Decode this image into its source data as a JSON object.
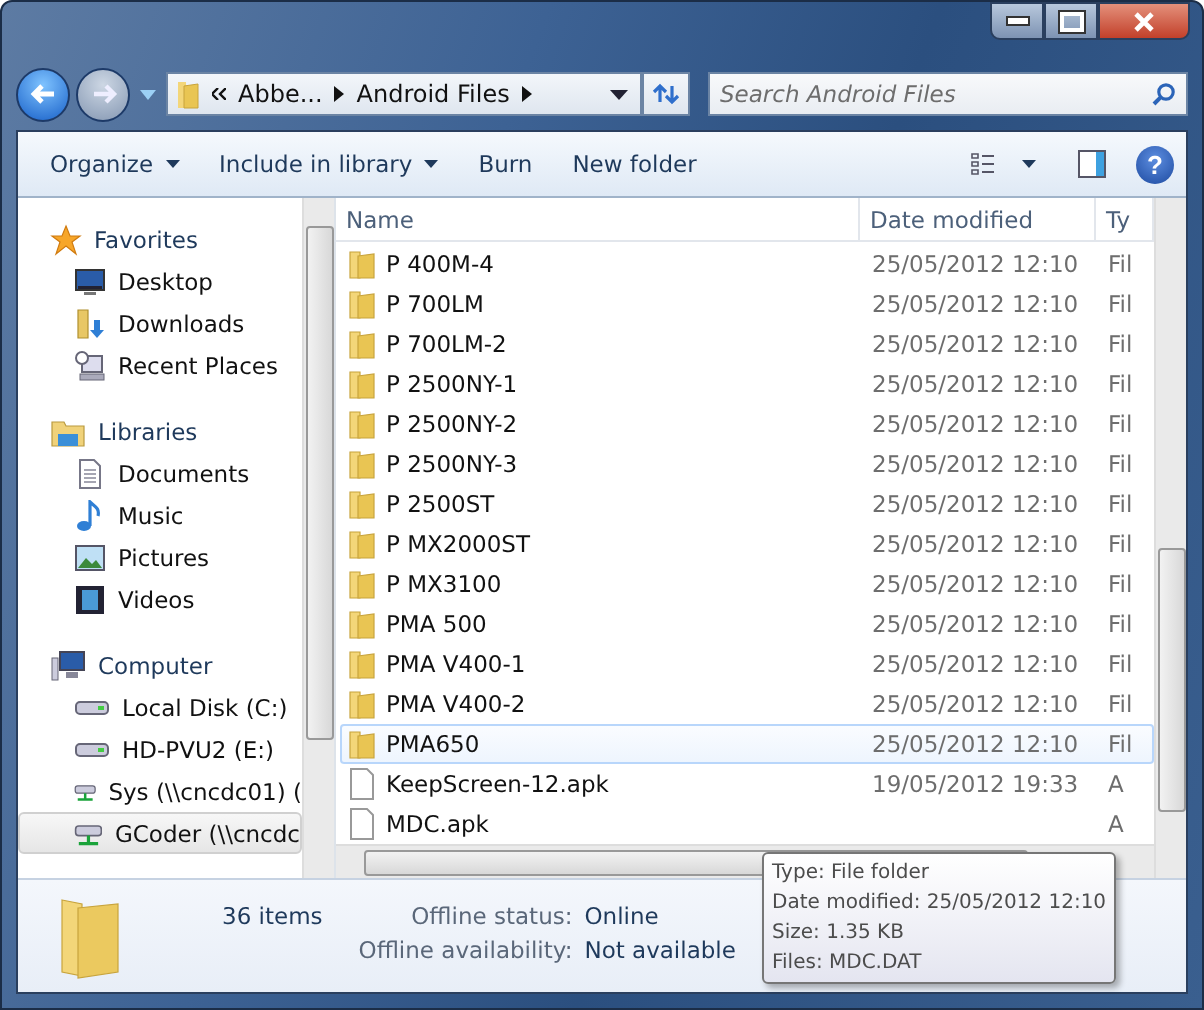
{
  "address_bar": {
    "segments": [
      "Abbe...",
      "Android Files"
    ]
  },
  "search": {
    "placeholder": "Search Android Files"
  },
  "help_button": "?",
  "toolbar": {
    "buttons": [
      {
        "label": "Organize",
        "dropdown": true
      },
      {
        "label": "Include in library",
        "dropdown": true
      },
      {
        "label": "Burn",
        "dropdown": false
      },
      {
        "label": "New folder",
        "dropdown": false
      }
    ]
  },
  "sidebar": {
    "groups": [
      {
        "label": "Favorites",
        "kind": "star",
        "children": [
          {
            "label": "Desktop",
            "kind": "desktop",
            "selected": false
          },
          {
            "label": "Downloads",
            "kind": "downloads",
            "selected": false
          },
          {
            "label": "Recent Places",
            "kind": "recent",
            "selected": false
          }
        ]
      },
      {
        "label": "Libraries",
        "kind": "library",
        "children": [
          {
            "label": "Documents",
            "kind": "document",
            "selected": false
          },
          {
            "label": "Music",
            "kind": "music",
            "selected": false
          },
          {
            "label": "Pictures",
            "kind": "picture",
            "selected": false
          },
          {
            "label": "Videos",
            "kind": "video",
            "selected": false
          }
        ]
      },
      {
        "label": "Computer",
        "kind": "computer",
        "children": [
          {
            "label": "Local Disk (C:)",
            "kind": "disk",
            "selected": false
          },
          {
            "label": "HD-PVU2 (E:)",
            "kind": "disk",
            "selected": false
          },
          {
            "label": "Sys (\\\\cncdc01) (",
            "kind": "network",
            "selected": false
          },
          {
            "label": "GCoder (\\\\cncdc",
            "kind": "network",
            "selected": true
          }
        ]
      }
    ]
  },
  "file_list": {
    "columns": [
      "Name",
      "Date modified",
      "Ty"
    ],
    "rows": [
      {
        "name": "P 400M-4",
        "date": "25/05/2012 12:10",
        "column_3": "Fil",
        "kind": "folder",
        "selected": false
      },
      {
        "name": "P 700LM",
        "date": "25/05/2012 12:10",
        "column_3": "Fil",
        "kind": "folder",
        "selected": false
      },
      {
        "name": "P 700LM-2",
        "date": "25/05/2012 12:10",
        "column_3": "Fil",
        "kind": "folder",
        "selected": false
      },
      {
        "name": "P 2500NY-1",
        "date": "25/05/2012 12:10",
        "column_3": "Fil",
        "kind": "folder",
        "selected": false
      },
      {
        "name": "P 2500NY-2",
        "date": "25/05/2012 12:10",
        "column_3": "Fil",
        "kind": "folder",
        "selected": false
      },
      {
        "name": "P 2500NY-3",
        "date": "25/05/2012 12:10",
        "column_3": "Fil",
        "kind": "folder",
        "selected": false
      },
      {
        "name": "P 2500ST",
        "date": "25/05/2012 12:10",
        "column_3": "Fil",
        "kind": "folder",
        "selected": false
      },
      {
        "name": "P MX2000ST",
        "date": "25/05/2012 12:10",
        "column_3": "Fil",
        "kind": "folder",
        "selected": false
      },
      {
        "name": "P MX3100",
        "date": "25/05/2012 12:10",
        "column_3": "Fil",
        "kind": "folder",
        "selected": false
      },
      {
        "name": "PMA 500",
        "date": "25/05/2012 12:10",
        "column_3": "Fil",
        "kind": "folder",
        "selected": false
      },
      {
        "name": "PMA V400-1",
        "date": "25/05/2012 12:10",
        "column_3": "Fil",
        "kind": "folder",
        "selected": false
      },
      {
        "name": "PMA V400-2",
        "date": "25/05/2012 12:10",
        "column_3": "Fil",
        "kind": "folder",
        "selected": false
      },
      {
        "name": "PMA650",
        "date": "25/05/2012 12:10",
        "column_3": "Fil",
        "kind": "folder",
        "selected": true
      },
      {
        "name": "KeepScreen-12.apk",
        "date": "19/05/2012 19:33",
        "column_3": "A",
        "kind": "file",
        "selected": false
      },
      {
        "name": "MDC.apk",
        "column_3": "A",
        "kind": "file",
        "selected": false
      }
    ]
  },
  "tooltip": [
    "Type: File folder",
    "Date modified: 25/05/2012 12:10",
    "Size: 1.35 KB",
    "Files: MDC.DAT"
  ],
  "details_pane": {
    "count": "36 items",
    "fields": [
      {
        "label": "Offline status:",
        "value": "Online"
      },
      {
        "label": "Offline availability:",
        "value": "Not available"
      }
    ]
  }
}
